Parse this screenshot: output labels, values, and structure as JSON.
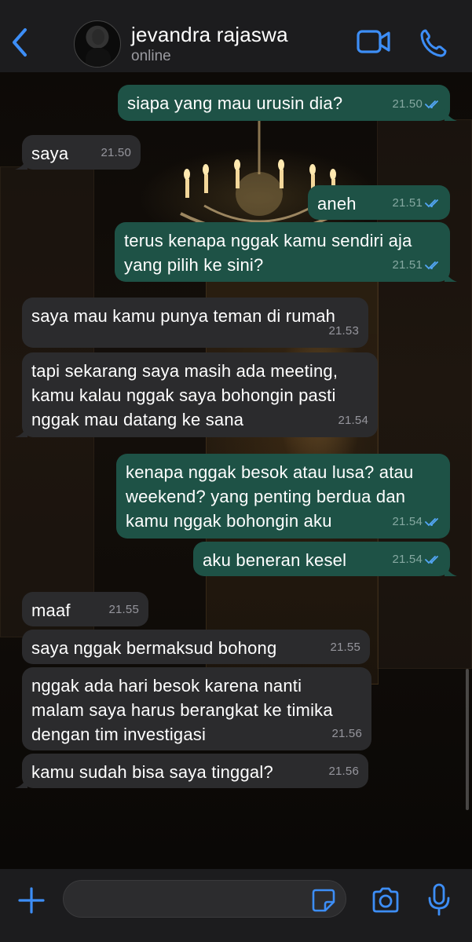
{
  "header": {
    "contact_name": "jevandra rajaswa",
    "status": "online",
    "icons": [
      "chevron-left-icon",
      "avatar",
      "video-camera-icon",
      "phone-icon"
    ]
  },
  "colors": {
    "accent": "#3d8ef7",
    "incoming_bubble": "#2b2b2d",
    "outgoing_bubble": "#1e5246",
    "read_tick": "#53a6f5"
  },
  "messages": [
    {
      "direction": "out",
      "text": "siapa yang mau urusin dia?",
      "time": "21.50",
      "read": true
    },
    {
      "direction": "in",
      "text": "saya",
      "time": "21.50"
    },
    {
      "direction": "out",
      "text": "aneh",
      "time": "21.51",
      "read": true
    },
    {
      "direction": "out",
      "text": "terus kenapa nggak kamu sendiri aja\nyang pilih ke sini?",
      "time": "21.51",
      "read": true
    },
    {
      "direction": "in",
      "text": "saya mau kamu punya teman di rumah",
      "time": "21.53"
    },
    {
      "direction": "in",
      "text": "tapi sekarang saya masih ada meeting,\nkamu kalau nggak saya bohongin pasti\nnggak mau datang ke sana",
      "time": "21.54"
    },
    {
      "direction": "out",
      "text": "kenapa nggak besok atau lusa? atau\nweekend? yang penting berdua dan\nkamu nggak bohongin aku",
      "time": "21.54",
      "read": true
    },
    {
      "direction": "out",
      "text": "aku beneran kesel",
      "time": "21.54",
      "read": true
    },
    {
      "direction": "in",
      "text": "maaf",
      "time": "21.55"
    },
    {
      "direction": "in",
      "text": "saya nggak bermaksud bohong",
      "time": "21.55"
    },
    {
      "direction": "in",
      "text": "nggak ada hari besok karena nanti\nmalam saya harus berangkat ke timika\ndengan tim investigasi",
      "time": "21.56"
    },
    {
      "direction": "in",
      "text": "kamu sudah bisa saya tinggal?",
      "time": "21.56"
    }
  ],
  "composer": {
    "value": "",
    "icons": [
      "plus-icon",
      "sticker-icon",
      "camera-icon",
      "microphone-icon"
    ]
  }
}
